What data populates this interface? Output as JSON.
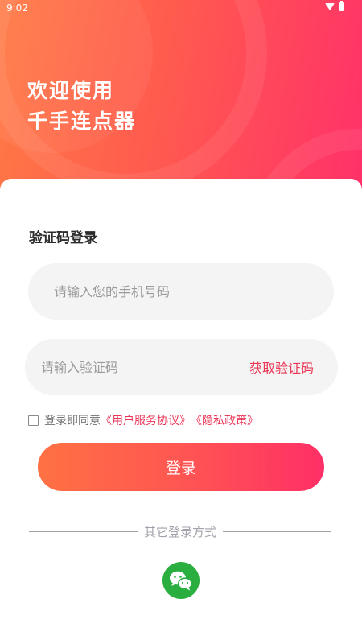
{
  "status_bar": {
    "time": "9:02",
    "icons": [
      "wifi-icon",
      "battery-icon"
    ]
  },
  "header": {
    "title_line1": "欢迎使用",
    "title_line2": "千手连点器"
  },
  "login_form": {
    "section_title": "验证码登录",
    "phone_placeholder": "请输入您的手机号码",
    "phone_value": "",
    "code_placeholder": "请输入验证码",
    "code_value": "",
    "get_code_label": "获取验证码",
    "agreement": {
      "checked": false,
      "prefix": "登录即同意",
      "terms_link": "《用户服务协议》",
      "privacy_link": "《隐私政策》"
    },
    "submit_label": "登录"
  },
  "other_login": {
    "divider_text": "其它登录方式",
    "methods": [
      {
        "icon": "wechat-icon"
      }
    ]
  },
  "colors": {
    "accent": "#ea3556",
    "gradient_start": "#ff7143",
    "gradient_end": "#ff2f66",
    "wechat": "#2aae3f"
  }
}
